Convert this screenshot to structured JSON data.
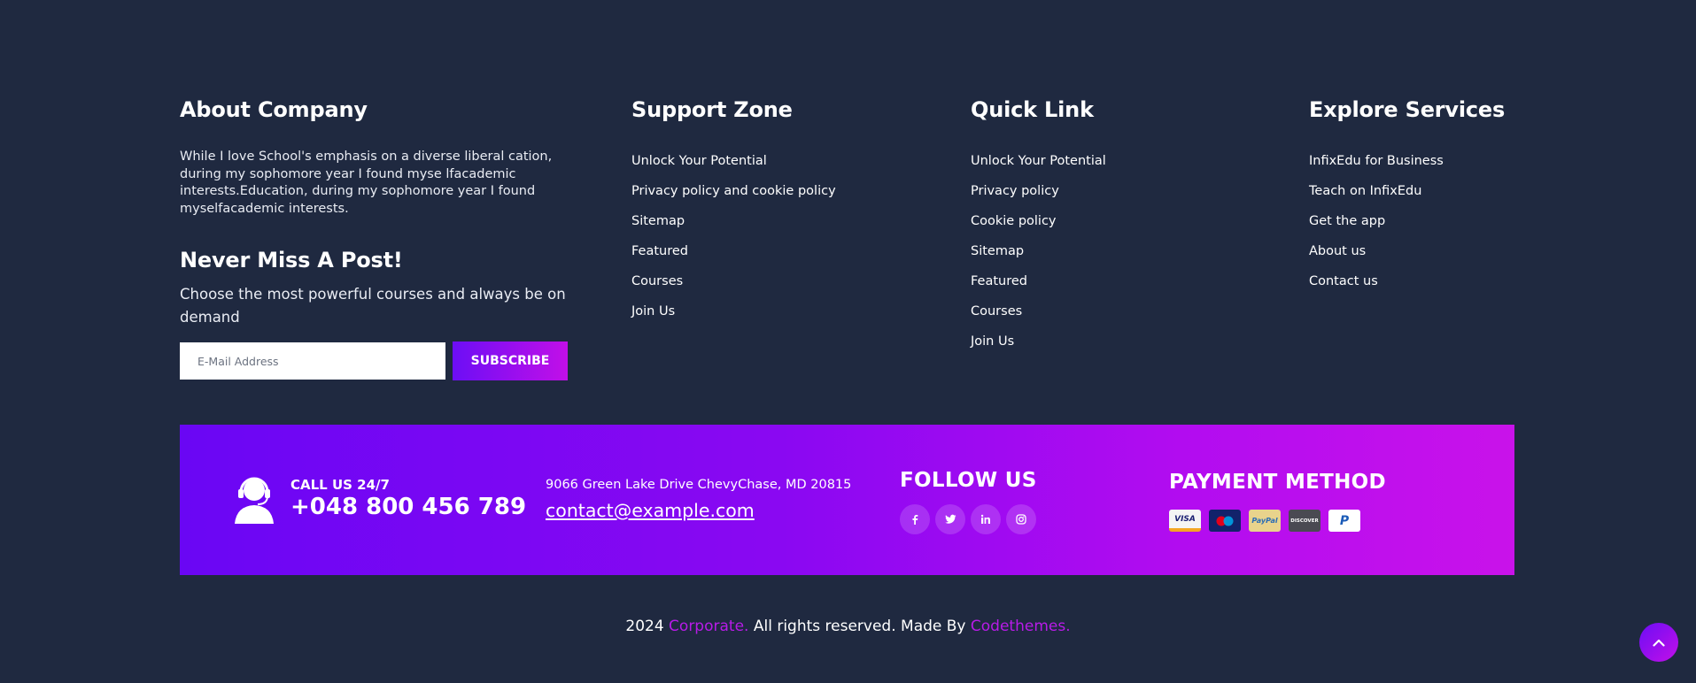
{
  "about": {
    "title": "About Company",
    "description": "While I love School's emphasis on a diverse liberal cation, during my sophomore year I found myse lfacademic interests.Education, during my sophomore year I found myselfacademic interests.",
    "newsletter_title": "Never Miss A Post!",
    "newsletter_text": "Choose the most powerful courses and always be on demand",
    "email_placeholder": "E-Mail Address",
    "subscribe_label": "SUBSCRIBE"
  },
  "support": {
    "title": "Support Zone",
    "links": [
      "Unlock Your Potential",
      "Privacy policy and cookie policy",
      "Sitemap",
      "Featured",
      "Courses",
      "Join Us"
    ]
  },
  "quick": {
    "title": "Quick Link",
    "links": [
      "Unlock Your Potential",
      "Privacy policy",
      "Cookie policy",
      "Sitemap",
      "Featured",
      "Courses",
      "Join Us"
    ]
  },
  "explore": {
    "title": "Explore Services",
    "links": [
      "InfixEdu for Business",
      "Teach on InfixEdu",
      "Get the app",
      "About us",
      "Contact us"
    ]
  },
  "contact": {
    "call_label": "CALL US 24/7",
    "phone": "+048 800 456 789",
    "address": "9066 Green Lake Drive ChevyChase, MD 20815",
    "email": "contact@example.com"
  },
  "follow": {
    "title": "FOLLOW US",
    "icons": [
      "facebook-icon",
      "twitter-icon",
      "linkedin-icon",
      "instagram-icon"
    ]
  },
  "payment": {
    "title": "PAYMENT METHOD",
    "cards": [
      {
        "name": "visa-card-icon",
        "label": "VISA"
      },
      {
        "name": "maestro-card-icon",
        "label": ""
      },
      {
        "name": "paypal-card-icon",
        "label": "PayPal"
      },
      {
        "name": "discover-card-icon",
        "label": "DISCOVER"
      },
      {
        "name": "paypal-logo-icon",
        "label": "P"
      }
    ]
  },
  "copyright": {
    "year": "2024",
    "brand": "Corporate.",
    "middle": "All rights reserved. Made By",
    "author": "Codethemes."
  },
  "colors": {
    "background": "#1f2940",
    "accent_start": "#6c0ef5",
    "accent_end": "#c20fe8",
    "highlight": "#b81be8"
  }
}
